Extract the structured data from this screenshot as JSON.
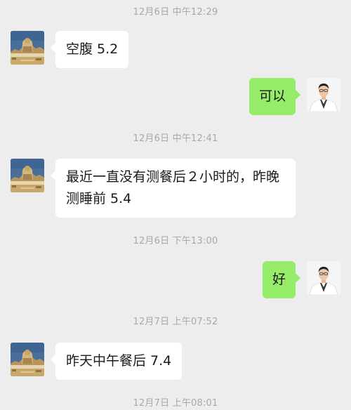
{
  "timestamps": [
    "12月6日 中午12:29",
    "12月6日 中午12:41",
    "12月6日 下午13:00",
    "12月7日 上午07:52",
    "12月7日 上午08:01"
  ],
  "messages": [
    {
      "side": "left",
      "text": "空腹 5.2",
      "avatar": "patient-statue-avatar"
    },
    {
      "side": "right",
      "text": "可以",
      "avatar": "doctor-avatar"
    },
    {
      "side": "left",
      "text": "最近一直没有测餐后２小时的，昨晚测睡前 5.4",
      "avatar": "patient-statue-avatar"
    },
    {
      "side": "right",
      "text": "好",
      "avatar": "doctor-avatar"
    },
    {
      "side": "left",
      "text": "昨天中午餐后 7.4",
      "avatar": "patient-statue-avatar"
    }
  ],
  "colors": {
    "background": "#ededed",
    "incoming_bubble": "#ffffff",
    "outgoing_bubble": "#95ec69",
    "timestamp_text": "#a8a8a8"
  }
}
